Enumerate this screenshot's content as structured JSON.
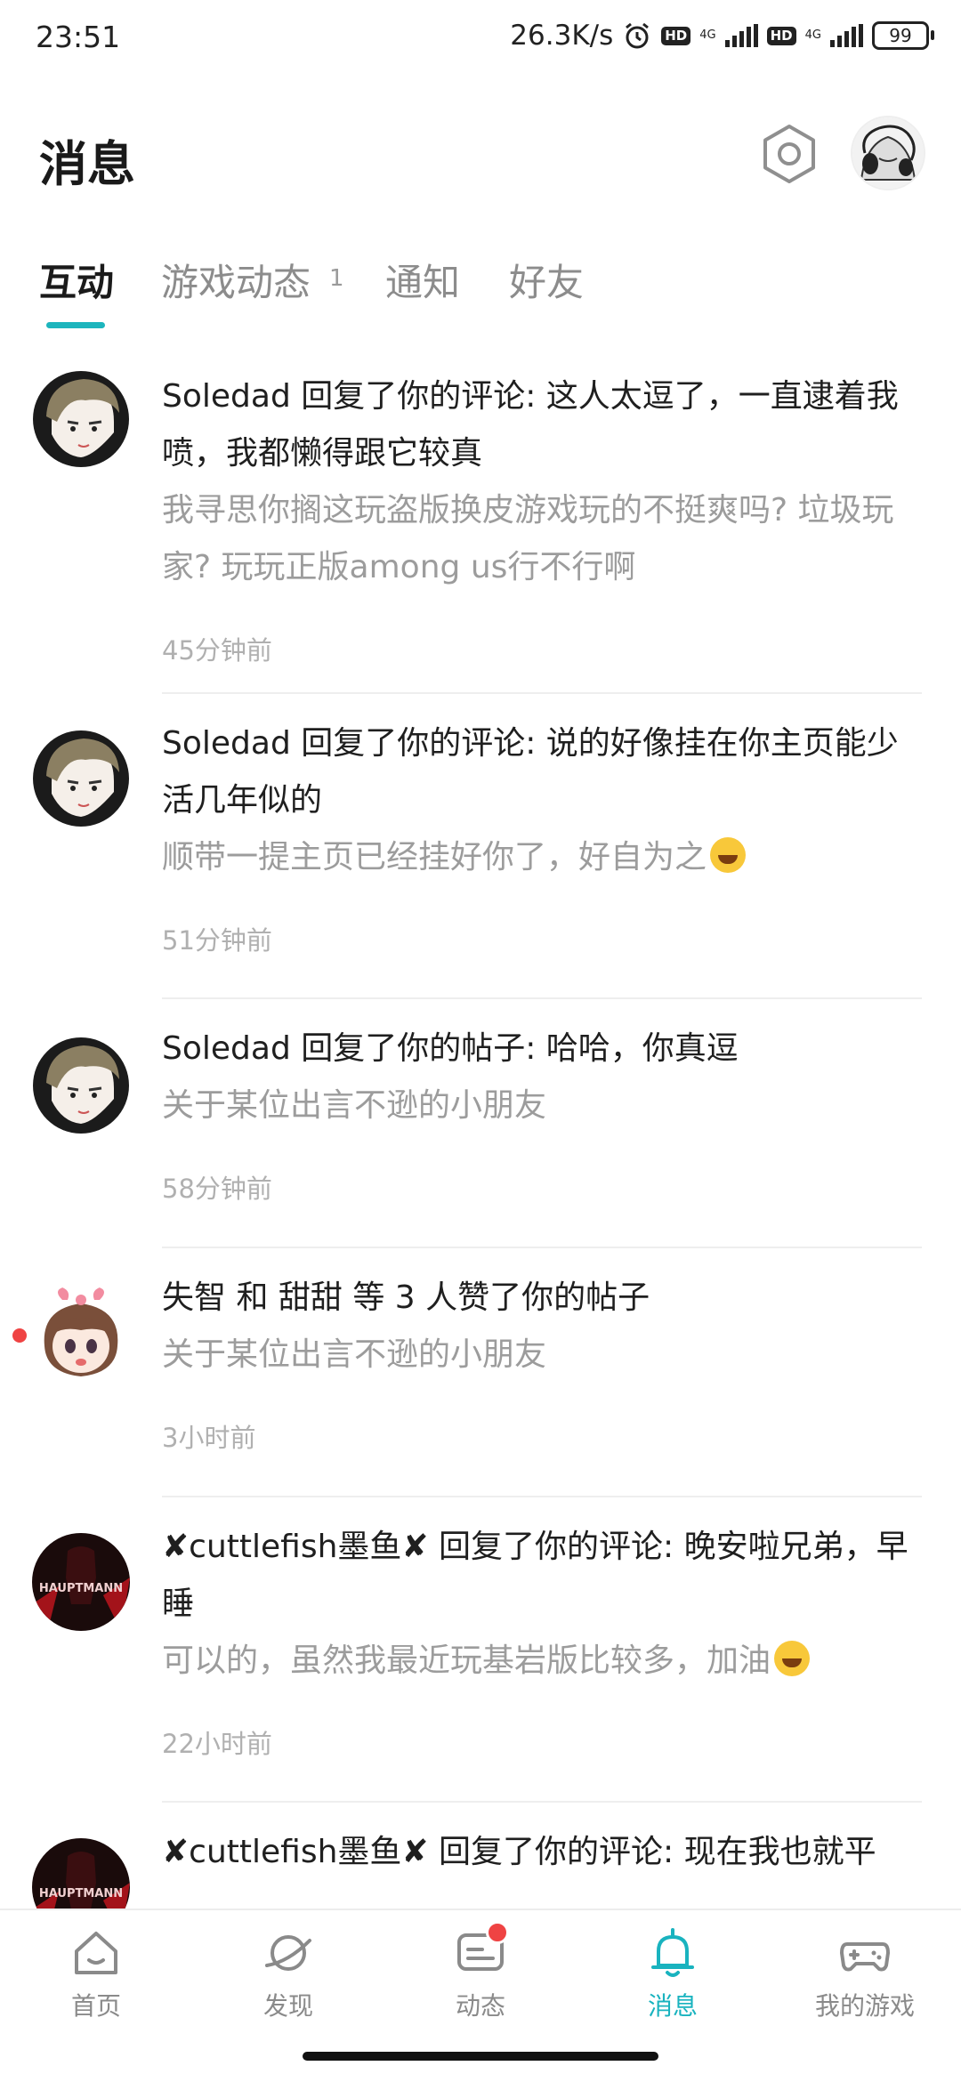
{
  "status_bar": {
    "time": "23:51",
    "net_speed": "26.3K/s",
    "hd1": "HD",
    "net1": "4G",
    "hd2": "HD",
    "net2": "4G",
    "battery": "99"
  },
  "header": {
    "title": "消息"
  },
  "tabs": [
    {
      "label": "互动",
      "active": true
    },
    {
      "label": "游戏动态",
      "badge": "1"
    },
    {
      "label": "通知"
    },
    {
      "label": "好友"
    }
  ],
  "messages": [
    {
      "main": "Soledad 回复了你的评论: 这人太逗了，一直逮着我喷，我都懒得跟它较真",
      "sub": "我寻思你搁这玩盗版换皮游戏玩的不挺爽吗? 垃圾玩家? 玩玩正版among us行不行啊",
      "time": "45分钟前"
    },
    {
      "main": "Soledad 回复了你的评论: 说的好像挂在你主页能少活几年似的",
      "sub": "顺带一提主页已经挂好你了，好自为之",
      "time": "51分钟前"
    },
    {
      "main": "Soledad 回复了你的帖子: 哈哈，你真逗",
      "sub": "关于某位出言不逊的小朋友",
      "time": "58分钟前"
    },
    {
      "main": "失智 和 甜甜 等 3 人赞了你的帖子",
      "sub": "关于某位出言不逊的小朋友",
      "time": "3小时前",
      "unread": true
    },
    {
      "main": "✘cuttlefish墨鱼✘ 回复了你的评论: 晚安啦兄弟，早睡",
      "sub": "可以的，虽然我最近玩基岩版比较多，加油",
      "time": "22小时前",
      "avatar_text": "HAUPTMANN"
    },
    {
      "main": "✘cuttlefish墨鱼✘ 回复了你的评论: 现在我也就平",
      "sub": "",
      "time": "",
      "avatar_text": "HAUPTMANN"
    }
  ],
  "bottom_nav": [
    {
      "label": "首页",
      "icon": "home-icon"
    },
    {
      "label": "发现",
      "icon": "planet-icon"
    },
    {
      "label": "动态",
      "icon": "feed-icon"
    },
    {
      "label": "消息",
      "icon": "bell-icon",
      "active": true
    },
    {
      "label": "我的游戏",
      "icon": "gamepad-icon"
    }
  ],
  "colors": {
    "accent": "#1db5bd",
    "unread": "#ef4343"
  }
}
